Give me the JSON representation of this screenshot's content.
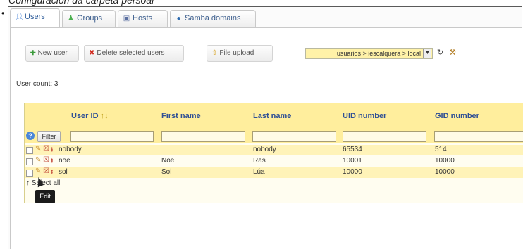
{
  "caption": "Configuración da carpeta persoal",
  "tabs": [
    {
      "label": "Users",
      "icon": "user-icon"
    },
    {
      "label": "Groups",
      "icon": "groups-icon"
    },
    {
      "label": "Hosts",
      "icon": "hosts-icon"
    },
    {
      "label": "Samba domains",
      "icon": "samba-domain-icon"
    }
  ],
  "toolbar": {
    "new_user": "New user",
    "delete_selected": "Delete selected users",
    "file_upload": "File upload",
    "ou_selected": "usuarios > iescalquera > local"
  },
  "user_count": "User count: 3",
  "table": {
    "columns": [
      "User ID",
      "First name",
      "Last name",
      "UID number",
      "GID number"
    ],
    "sort_indicator": "↑↓",
    "filter_label": "Filter",
    "rows": [
      {
        "user_id": "nobody",
        "first_name": "",
        "last_name": "nobody",
        "uid": "65534",
        "gid": "514"
      },
      {
        "user_id": "noe",
        "first_name": "Noe",
        "last_name": "Ras",
        "uid": "10001",
        "gid": "10000"
      },
      {
        "user_id": "sol",
        "first_name": "Sol",
        "last_name": "Lúa",
        "uid": "10000",
        "gid": "10000"
      }
    ],
    "select_all": "Select all"
  },
  "tooltip": "Edit",
  "colors": {
    "header_bg": "#ffee9d",
    "row_alt": "#fff3b8",
    "link": "#2f4f95",
    "select_bg": "#fff2a8"
  }
}
